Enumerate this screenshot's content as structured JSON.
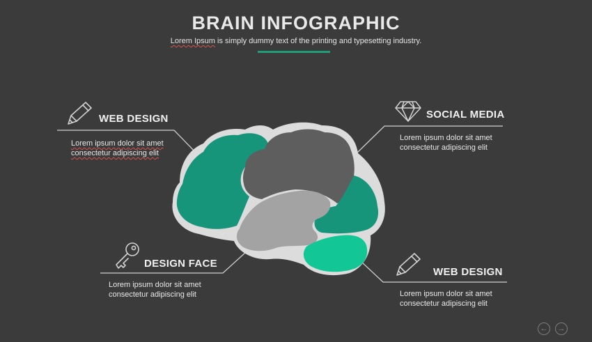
{
  "header": {
    "title": "BRAIN INFOGRAPHIC",
    "subtitle_word": "Lorem Ipsum",
    "subtitle_rest": " is simply dummy text of the printing and typesetting industry."
  },
  "colors": {
    "background": "#3b3b3b",
    "accent_line": "#1f9c78",
    "lobe_green": "#16957a",
    "lobe_green_light": "#12c795",
    "lobe_dark_gray": "#5e5e5e",
    "lobe_light_gray": "#a3a3a3",
    "brain_outline": "#dcdcdc"
  },
  "sections": {
    "top_left": {
      "icon": "pencil-icon",
      "title": "WEB DESIGN",
      "line1": "Lorem ipsum dolor sit amet",
      "line2": "consectetur adipiscing elit"
    },
    "top_right": {
      "icon": "diamond-icon",
      "title": "SOCIAL MEDIA",
      "line1": "Lorem ipsum dolor sit amet",
      "line2": "consectetur adipiscing elit"
    },
    "bottom_left": {
      "icon": "key-icon",
      "title": "DESIGN FACE",
      "line1": "Lorem ipsum dolor sit amet",
      "line2": "consectetur adipiscing elit"
    },
    "bottom_right": {
      "icon": "pencil-icon",
      "title": "WEB DESIGN",
      "line1": "Lorem ipsum dolor sit amet",
      "line2": "consectetur adipiscing elit"
    }
  },
  "navigation": {
    "prev_icon": "arrow-left-icon",
    "next_icon": "arrow-right-icon"
  }
}
